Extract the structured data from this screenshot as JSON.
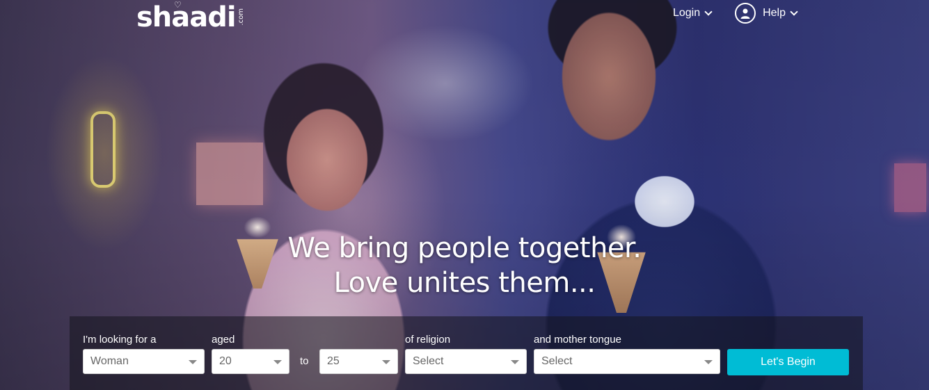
{
  "brand": {
    "logo_text": "shaadi",
    "logo_suffix": ".com"
  },
  "nav": {
    "login_label": "Login",
    "help_label": "Help"
  },
  "hero": {
    "line1": "We bring people together.",
    "line2": "Love unites them..."
  },
  "search": {
    "looking_for_label": "I'm looking for a",
    "looking_for_value": "Woman",
    "aged_label": "aged",
    "age_from_value": "20",
    "to_label": "to",
    "age_to_value": "25",
    "religion_label": "of religion",
    "religion_value": "Select",
    "mother_tongue_label": "and mother tongue",
    "mother_tongue_value": "Select",
    "submit_label": "Let's Begin"
  },
  "colors": {
    "accent": "#00bcd5",
    "text_on_dark": "#ffffff"
  },
  "icons": {
    "user": "user-circle-icon",
    "chevron": "chevron-down-icon",
    "caret": "caret-down-icon"
  }
}
